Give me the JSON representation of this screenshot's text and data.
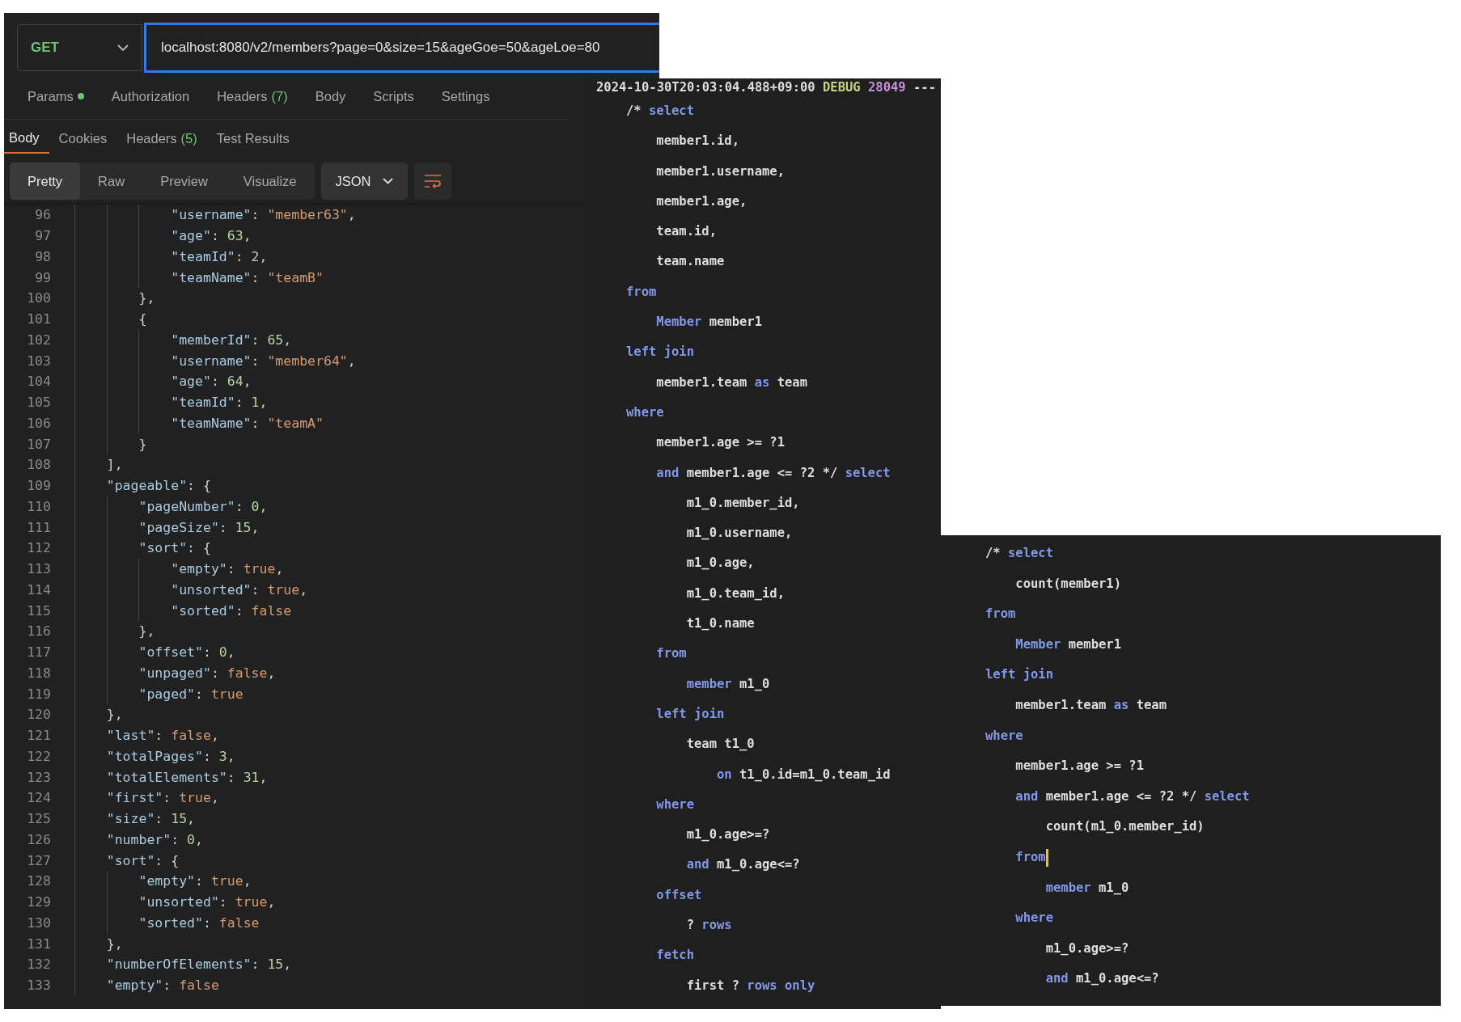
{
  "postman": {
    "method": "GET",
    "url": "localhost:8080/v2/members?page=0&size=15&ageGoe=50&ageLoe=80",
    "request_tabs": [
      {
        "label": "Params",
        "dot": true,
        "selected": false
      },
      {
        "label": "Authorization",
        "selected": false
      },
      {
        "label": "Headers",
        "count": "(7)",
        "selected": false
      },
      {
        "label": "Body",
        "selected": false
      },
      {
        "label": "Scripts",
        "selected": false
      },
      {
        "label": "Settings",
        "selected": false
      }
    ],
    "response_tabs": [
      {
        "label": "Body",
        "selected": true
      },
      {
        "label": "Cookies",
        "selected": false
      },
      {
        "label": "Headers",
        "count": "(5)",
        "selected": false
      },
      {
        "label": "Test Results",
        "selected": false
      }
    ],
    "view_modes": [
      {
        "label": "Pretty",
        "selected": true
      },
      {
        "label": "Raw",
        "selected": false
      },
      {
        "label": "Preview",
        "selected": false
      },
      {
        "label": "Visualize",
        "selected": false
      }
    ],
    "format": "JSON",
    "code": [
      {
        "n": "96",
        "t": [
          {
            "kind": "key",
            "text": "            \"username\""
          },
          {
            "kind": "punct",
            "text": ": "
          },
          {
            "kind": "string",
            "text": "\"member63\""
          },
          {
            "kind": "punct",
            "text": ","
          }
        ]
      },
      {
        "n": "97",
        "t": [
          {
            "kind": "key",
            "text": "            \"age\""
          },
          {
            "kind": "punct",
            "text": ": "
          },
          {
            "kind": "number",
            "text": "63"
          },
          {
            "kind": "punct",
            "text": ","
          }
        ]
      },
      {
        "n": "98",
        "t": [
          {
            "kind": "key",
            "text": "            \"teamId\""
          },
          {
            "kind": "punct",
            "text": ": "
          },
          {
            "kind": "number",
            "text": "2"
          },
          {
            "kind": "punct",
            "text": ","
          }
        ]
      },
      {
        "n": "99",
        "t": [
          {
            "kind": "key",
            "text": "            \"teamName\""
          },
          {
            "kind": "punct",
            "text": ": "
          },
          {
            "kind": "string",
            "text": "\"teamB\""
          }
        ]
      },
      {
        "n": "100",
        "t": [
          {
            "kind": "punct",
            "text": "        },"
          }
        ]
      },
      {
        "n": "101",
        "t": [
          {
            "kind": "punct",
            "text": "        {"
          }
        ]
      },
      {
        "n": "102",
        "t": [
          {
            "kind": "key",
            "text": "            \"memberId\""
          },
          {
            "kind": "punct",
            "text": ": "
          },
          {
            "kind": "number",
            "text": "65"
          },
          {
            "kind": "punct",
            "text": ","
          }
        ]
      },
      {
        "n": "103",
        "t": [
          {
            "kind": "key",
            "text": "            \"username\""
          },
          {
            "kind": "punct",
            "text": ": "
          },
          {
            "kind": "string",
            "text": "\"member64\""
          },
          {
            "kind": "punct",
            "text": ","
          }
        ]
      },
      {
        "n": "104",
        "t": [
          {
            "kind": "key",
            "text": "            \"age\""
          },
          {
            "kind": "punct",
            "text": ": "
          },
          {
            "kind": "number",
            "text": "64"
          },
          {
            "kind": "punct",
            "text": ","
          }
        ]
      },
      {
        "n": "105",
        "t": [
          {
            "kind": "key",
            "text": "            \"teamId\""
          },
          {
            "kind": "punct",
            "text": ": "
          },
          {
            "kind": "number",
            "text": "1"
          },
          {
            "kind": "punct",
            "text": ","
          }
        ]
      },
      {
        "n": "106",
        "t": [
          {
            "kind": "key",
            "text": "            \"teamName\""
          },
          {
            "kind": "punct",
            "text": ": "
          },
          {
            "kind": "string",
            "text": "\"teamA\""
          }
        ]
      },
      {
        "n": "107",
        "t": [
          {
            "kind": "punct",
            "text": "        }"
          }
        ]
      },
      {
        "n": "108",
        "t": [
          {
            "kind": "punct",
            "text": "    ],"
          }
        ]
      },
      {
        "n": "109",
        "t": [
          {
            "kind": "key",
            "text": "    \"pageable\""
          },
          {
            "kind": "punct",
            "text": ": {"
          }
        ]
      },
      {
        "n": "110",
        "t": [
          {
            "kind": "key",
            "text": "        \"pageNumber\""
          },
          {
            "kind": "punct",
            "text": ": "
          },
          {
            "kind": "number",
            "text": "0"
          },
          {
            "kind": "punct",
            "text": ","
          }
        ]
      },
      {
        "n": "111",
        "t": [
          {
            "kind": "key",
            "text": "        \"pageSize\""
          },
          {
            "kind": "punct",
            "text": ": "
          },
          {
            "kind": "number",
            "text": "15"
          },
          {
            "kind": "punct",
            "text": ","
          }
        ]
      },
      {
        "n": "112",
        "t": [
          {
            "kind": "key",
            "text": "        \"sort\""
          },
          {
            "kind": "punct",
            "text": ": {"
          }
        ]
      },
      {
        "n": "113",
        "t": [
          {
            "kind": "key",
            "text": "            \"empty\""
          },
          {
            "kind": "punct",
            "text": ": "
          },
          {
            "kind": "bool",
            "text": "true"
          },
          {
            "kind": "punct",
            "text": ","
          }
        ]
      },
      {
        "n": "114",
        "t": [
          {
            "kind": "key",
            "text": "            \"unsorted\""
          },
          {
            "kind": "punct",
            "text": ": "
          },
          {
            "kind": "bool",
            "text": "true"
          },
          {
            "kind": "punct",
            "text": ","
          }
        ]
      },
      {
        "n": "115",
        "t": [
          {
            "kind": "key",
            "text": "            \"sorted\""
          },
          {
            "kind": "punct",
            "text": ": "
          },
          {
            "kind": "bool",
            "text": "false"
          }
        ]
      },
      {
        "n": "116",
        "t": [
          {
            "kind": "punct",
            "text": "        },"
          }
        ]
      },
      {
        "n": "117",
        "t": [
          {
            "kind": "key",
            "text": "        \"offset\""
          },
          {
            "kind": "punct",
            "text": ": "
          },
          {
            "kind": "number",
            "text": "0"
          },
          {
            "kind": "punct",
            "text": ","
          }
        ]
      },
      {
        "n": "118",
        "t": [
          {
            "kind": "key",
            "text": "        \"unpaged\""
          },
          {
            "kind": "punct",
            "text": ": "
          },
          {
            "kind": "bool",
            "text": "false"
          },
          {
            "kind": "punct",
            "text": ","
          }
        ]
      },
      {
        "n": "119",
        "t": [
          {
            "kind": "key",
            "text": "        \"paged\""
          },
          {
            "kind": "punct",
            "text": ": "
          },
          {
            "kind": "bool",
            "text": "true"
          }
        ]
      },
      {
        "n": "120",
        "t": [
          {
            "kind": "punct",
            "text": "    },"
          }
        ]
      },
      {
        "n": "121",
        "t": [
          {
            "kind": "key",
            "text": "    \"last\""
          },
          {
            "kind": "punct",
            "text": ": "
          },
          {
            "kind": "bool",
            "text": "false"
          },
          {
            "kind": "punct",
            "text": ","
          }
        ]
      },
      {
        "n": "122",
        "t": [
          {
            "kind": "key",
            "text": "    \"totalPages\""
          },
          {
            "kind": "punct",
            "text": ": "
          },
          {
            "kind": "number",
            "text": "3"
          },
          {
            "kind": "punct",
            "text": ","
          }
        ]
      },
      {
        "n": "123",
        "t": [
          {
            "kind": "key",
            "text": "    \"totalElements\""
          },
          {
            "kind": "punct",
            "text": ": "
          },
          {
            "kind": "number",
            "text": "31"
          },
          {
            "kind": "punct",
            "text": ","
          }
        ]
      },
      {
        "n": "124",
        "t": [
          {
            "kind": "key",
            "text": "    \"first\""
          },
          {
            "kind": "punct",
            "text": ": "
          },
          {
            "kind": "bool",
            "text": "true"
          },
          {
            "kind": "punct",
            "text": ","
          }
        ]
      },
      {
        "n": "125",
        "t": [
          {
            "kind": "key",
            "text": "    \"size\""
          },
          {
            "kind": "punct",
            "text": ": "
          },
          {
            "kind": "number",
            "text": "15"
          },
          {
            "kind": "punct",
            "text": ","
          }
        ]
      },
      {
        "n": "126",
        "t": [
          {
            "kind": "key",
            "text": "    \"number\""
          },
          {
            "kind": "punct",
            "text": ": "
          },
          {
            "kind": "number",
            "text": "0"
          },
          {
            "kind": "punct",
            "text": ","
          }
        ]
      },
      {
        "n": "127",
        "t": [
          {
            "kind": "key",
            "text": "    \"sort\""
          },
          {
            "kind": "punct",
            "text": ": {"
          }
        ]
      },
      {
        "n": "128",
        "t": [
          {
            "kind": "key",
            "text": "        \"empty\""
          },
          {
            "kind": "punct",
            "text": ": "
          },
          {
            "kind": "bool",
            "text": "true"
          },
          {
            "kind": "punct",
            "text": ","
          }
        ]
      },
      {
        "n": "129",
        "t": [
          {
            "kind": "key",
            "text": "        \"unsorted\""
          },
          {
            "kind": "punct",
            "text": ": "
          },
          {
            "kind": "bool",
            "text": "true"
          },
          {
            "kind": "punct",
            "text": ","
          }
        ]
      },
      {
        "n": "130",
        "t": [
          {
            "kind": "key",
            "text": "        \"sorted\""
          },
          {
            "kind": "punct",
            "text": ": "
          },
          {
            "kind": "bool",
            "text": "false"
          }
        ]
      },
      {
        "n": "131",
        "t": [
          {
            "kind": "punct",
            "text": "    },"
          }
        ]
      },
      {
        "n": "132",
        "t": [
          {
            "kind": "key",
            "text": "    \"numberOfElements\""
          },
          {
            "kind": "punct",
            "text": ": "
          },
          {
            "kind": "number",
            "text": "15"
          },
          {
            "kind": "punct",
            "text": ","
          }
        ]
      },
      {
        "n": "133",
        "t": [
          {
            "kind": "key",
            "text": "    \"empty\""
          },
          {
            "kind": "punct",
            "text": ": "
          },
          {
            "kind": "bool",
            "text": "false"
          }
        ]
      }
    ]
  },
  "log": {
    "header": [
      {
        "kind": "time",
        "text": "2024-10-30T20:03:04.488+09:00"
      },
      {
        "kind": "level",
        "text": "DEBUG"
      },
      {
        "kind": "pid",
        "text": "28049"
      },
      {
        "kind": "plain",
        "text": "---"
      }
    ],
    "lines": [
      {
        "t": [
          {
            "kind": "plain",
            "text": "/*"
          },
          {
            "kind": "keyword",
            "text": " select"
          }
        ]
      },
      {
        "t": [
          {
            "kind": "plain",
            "text": "    member1.id,"
          }
        ]
      },
      {
        "t": [
          {
            "kind": "plain",
            "text": "    member1.username,"
          }
        ]
      },
      {
        "t": [
          {
            "kind": "plain",
            "text": "    member1.age,"
          }
        ]
      },
      {
        "t": [
          {
            "kind": "plain",
            "text": "    team.id,"
          }
        ]
      },
      {
        "t": [
          {
            "kind": "plain",
            "text": "    team.name"
          }
        ]
      },
      {
        "t": [
          {
            "kind": "keyword",
            "text": "from"
          }
        ]
      },
      {
        "t": [
          {
            "kind": "keyword",
            "text": "    Member"
          },
          {
            "kind": "plain",
            "text": " member1"
          }
        ]
      },
      {
        "t": [
          {
            "kind": "keyword",
            "text": "left join"
          }
        ]
      },
      {
        "t": [
          {
            "kind": "plain",
            "text": "    member1.team"
          },
          {
            "kind": "keyword",
            "text": " as"
          },
          {
            "kind": "plain",
            "text": " team"
          }
        ]
      },
      {
        "t": [
          {
            "kind": "keyword",
            "text": "where"
          }
        ]
      },
      {
        "t": [
          {
            "kind": "plain",
            "text": "    member1.age >= ?1"
          }
        ]
      },
      {
        "t": [
          {
            "kind": "keyword",
            "text": "    and"
          },
          {
            "kind": "plain",
            "text": " member1.age <= ?2 */"
          },
          {
            "kind": "keyword",
            "text": " select"
          }
        ]
      },
      {
        "t": [
          {
            "kind": "plain",
            "text": "        m1_0.member_id,"
          }
        ]
      },
      {
        "t": [
          {
            "kind": "plain",
            "text": "        m1_0.username,"
          }
        ]
      },
      {
        "t": [
          {
            "kind": "plain",
            "text": "        m1_0.age,"
          }
        ]
      },
      {
        "t": [
          {
            "kind": "plain",
            "text": "        m1_0.team_id,"
          }
        ]
      },
      {
        "t": [
          {
            "kind": "plain",
            "text": "        t1_0.name"
          }
        ]
      },
      {
        "t": [
          {
            "kind": "keyword",
            "text": "    from"
          }
        ]
      },
      {
        "t": [
          {
            "kind": "keyword",
            "text": "        member"
          },
          {
            "kind": "plain",
            "text": " m1_0"
          }
        ]
      },
      {
        "t": [
          {
            "kind": "keyword",
            "text": "    left join"
          }
        ]
      },
      {
        "t": [
          {
            "kind": "plain",
            "text": "        team t1_0"
          }
        ]
      },
      {
        "t": [
          {
            "kind": "keyword",
            "text": "            on"
          },
          {
            "kind": "plain",
            "text": " t1_0.id=m1_0.team_id"
          }
        ]
      },
      {
        "t": [
          {
            "kind": "keyword",
            "text": "    where"
          }
        ]
      },
      {
        "t": [
          {
            "kind": "plain",
            "text": "        m1_0.age>=?"
          }
        ]
      },
      {
        "t": [
          {
            "kind": "keyword",
            "text": "        and"
          },
          {
            "kind": "plain",
            "text": " m1_0.age<=?"
          }
        ]
      },
      {
        "t": [
          {
            "kind": "keyword",
            "text": "    offset"
          }
        ]
      },
      {
        "t": [
          {
            "kind": "plain",
            "text": "        ?"
          },
          {
            "kind": "keyword",
            "text": " rows"
          }
        ]
      },
      {
        "t": [
          {
            "kind": "keyword",
            "text": "    fetch"
          }
        ]
      },
      {
        "t": [
          {
            "kind": "plain",
            "text": "        first ?"
          },
          {
            "kind": "keyword",
            "text": " rows only"
          }
        ]
      }
    ]
  },
  "log2": {
    "lines": [
      {
        "t": [
          {
            "kind": "plain",
            "text": "/*"
          },
          {
            "kind": "keyword",
            "text": " select"
          }
        ]
      },
      {
        "t": [
          {
            "kind": "plain",
            "text": "    count(member1)"
          }
        ]
      },
      {
        "t": [
          {
            "kind": "keyword",
            "text": "from"
          }
        ]
      },
      {
        "t": [
          {
            "kind": "keyword",
            "text": "    Member"
          },
          {
            "kind": "plain",
            "text": " member1"
          }
        ]
      },
      {
        "t": [
          {
            "kind": "keyword",
            "text": "left join"
          }
        ]
      },
      {
        "t": [
          {
            "kind": "plain",
            "text": "    member1.team"
          },
          {
            "kind": "keyword",
            "text": " as"
          },
          {
            "kind": "plain",
            "text": " team"
          }
        ]
      },
      {
        "t": [
          {
            "kind": "keyword",
            "text": "where"
          }
        ]
      },
      {
        "t": [
          {
            "kind": "plain",
            "text": "    member1.age >= ?1"
          }
        ]
      },
      {
        "t": [
          {
            "kind": "keyword",
            "text": "    and"
          },
          {
            "kind": "plain",
            "text": " member1.age <= ?2 */"
          },
          {
            "kind": "keyword",
            "text": " select"
          }
        ]
      },
      {
        "t": [
          {
            "kind": "plain",
            "text": "        count(m1_0.member_id)"
          }
        ]
      },
      {
        "t": [
          {
            "kind": "keyword",
            "text": "    from"
          }
        ],
        "caret": true
      },
      {
        "t": [
          {
            "kind": "keyword",
            "text": "        member"
          },
          {
            "kind": "plain",
            "text": " m1_0"
          }
        ]
      },
      {
        "t": [
          {
            "kind": "keyword",
            "text": "    where"
          }
        ]
      },
      {
        "t": [
          {
            "kind": "plain",
            "text": "        m1_0.age>=?"
          }
        ]
      },
      {
        "t": [
          {
            "kind": "keyword",
            "text": "        and"
          },
          {
            "kind": "plain",
            "text": " m1_0.age<=?"
          }
        ]
      }
    ]
  }
}
